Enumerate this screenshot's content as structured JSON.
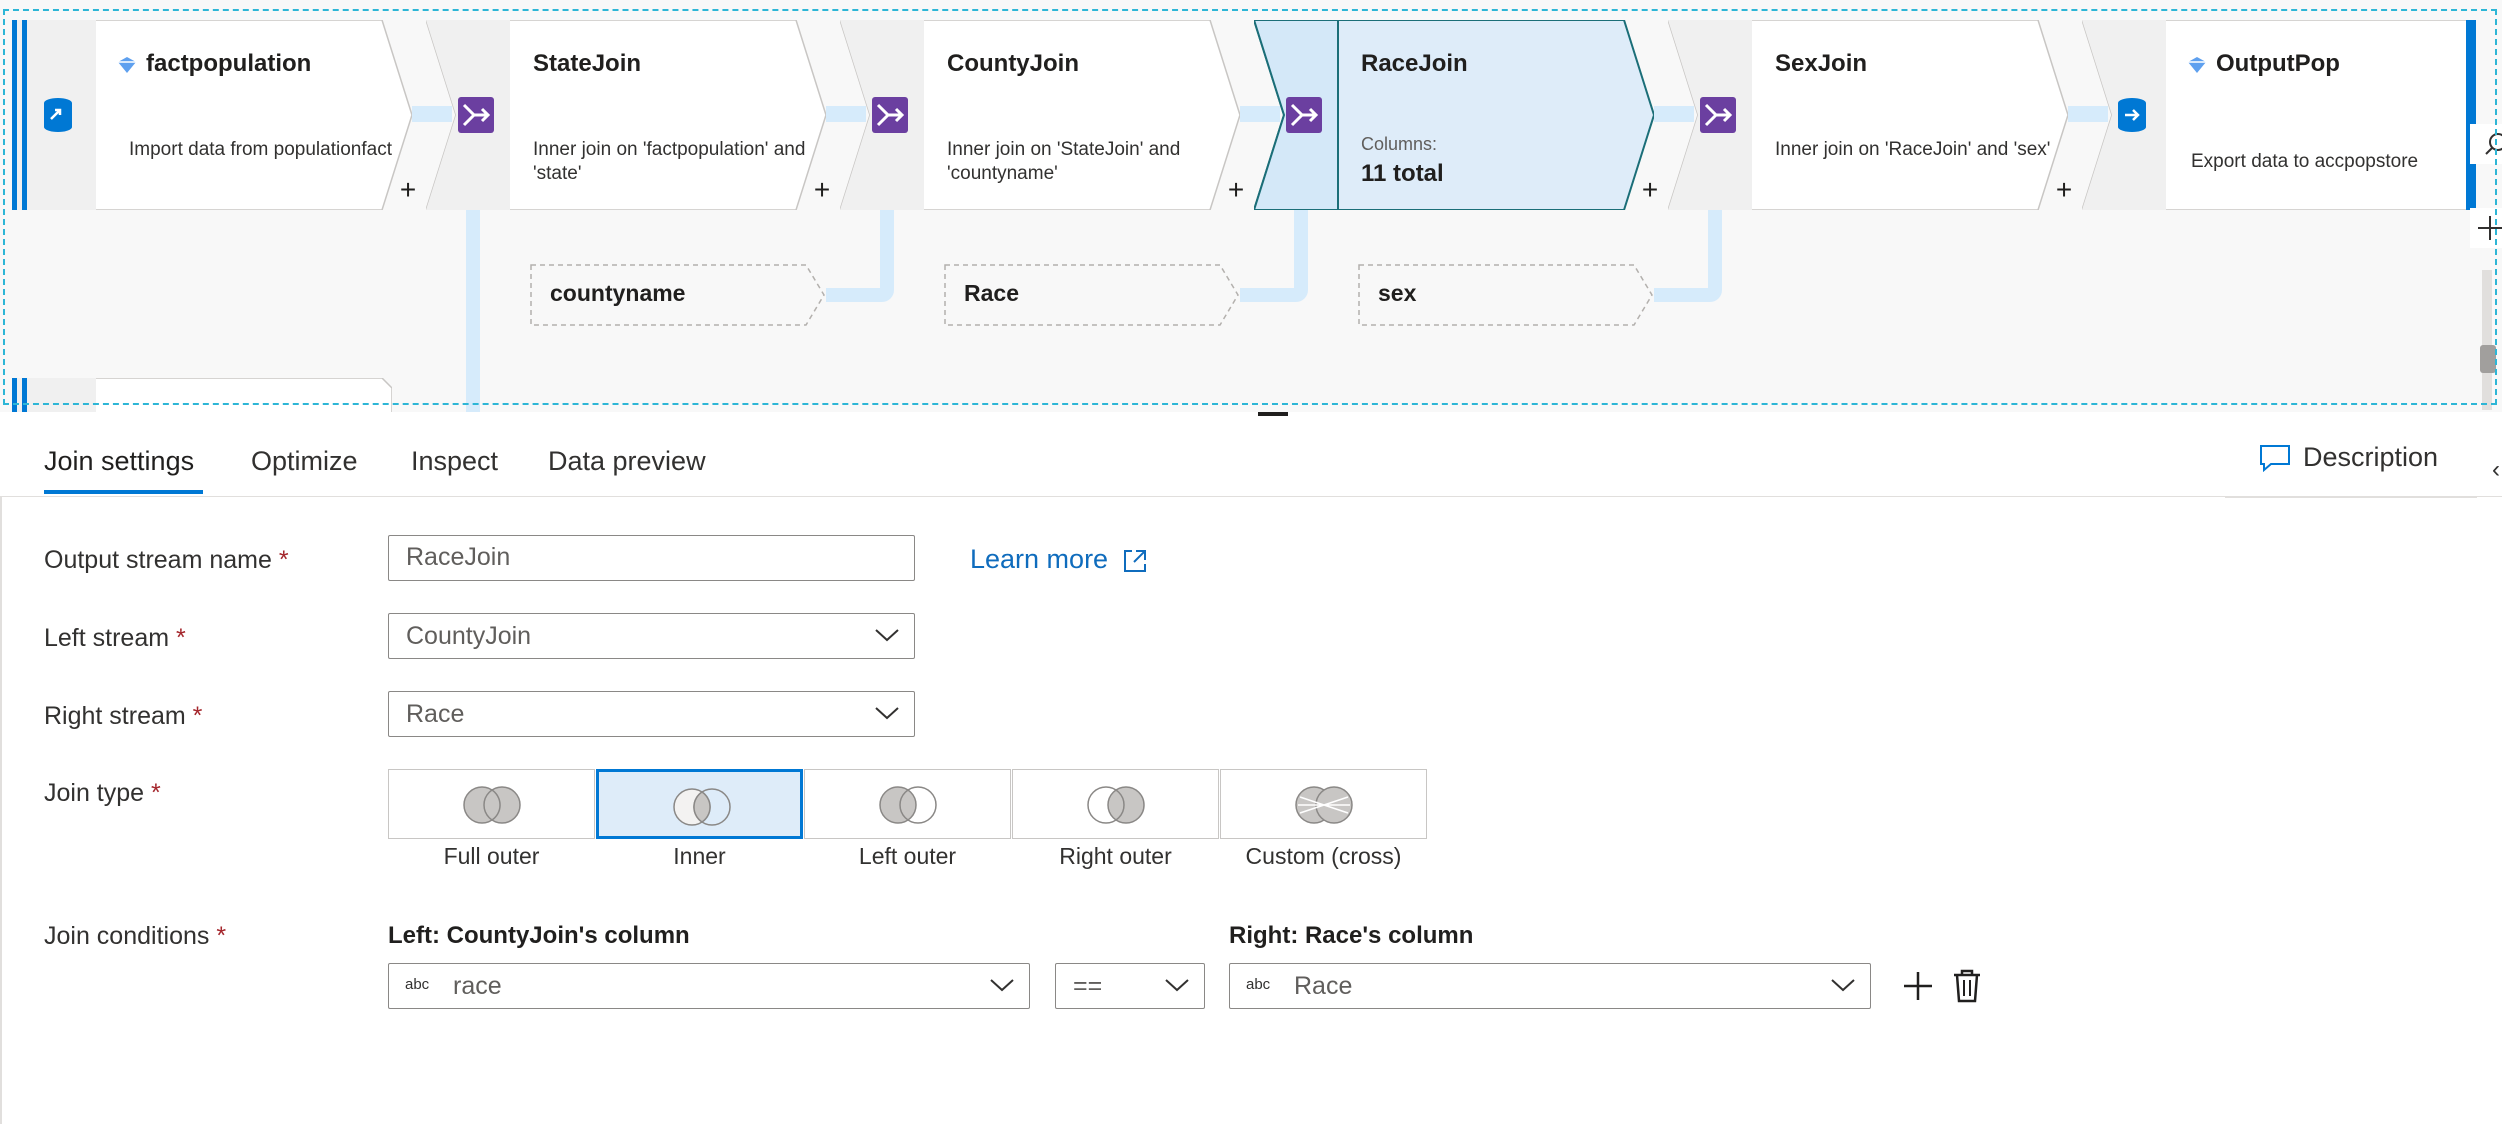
{
  "canvas": {
    "nodes": [
      {
        "id": "factpopulation",
        "title": "factpopulation",
        "desc": "Import data from populationfact",
        "kind": "source"
      },
      {
        "id": "statejoin",
        "title": "StateJoin",
        "desc": "Inner join on 'factpopulation' and 'state'",
        "kind": "join"
      },
      {
        "id": "countyjoin",
        "title": "CountyJoin",
        "desc": "Inner join on 'StateJoin' and 'countyname'",
        "kind": "join"
      },
      {
        "id": "racejoin",
        "title": "RaceJoin",
        "columns_label": "Columns:",
        "columns_value": "11 total",
        "kind": "join",
        "selected": true
      },
      {
        "id": "sexjoin",
        "title": "SexJoin",
        "desc": "Inner join on 'RaceJoin' and 'sex'",
        "kind": "join"
      },
      {
        "id": "outputpop",
        "title": "OutputPop",
        "desc": "Export data to accpopstore",
        "kind": "sink"
      }
    ],
    "plus": "+",
    "stream_tags": [
      "countyname",
      "Race",
      "sex"
    ]
  },
  "tabs": [
    {
      "label": "Join settings",
      "active": true
    },
    {
      "label": "Optimize"
    },
    {
      "label": "Inspect"
    },
    {
      "label": "Data preview"
    }
  ],
  "description_button": "Description",
  "form": {
    "output_stream_label": "Output stream name",
    "output_stream_value": "RaceJoin",
    "learn_more": "Learn more",
    "left_stream_label": "Left stream",
    "left_stream_value": "CountyJoin",
    "right_stream_label": "Right stream",
    "right_stream_value": "Race",
    "join_type_label": "Join type",
    "join_types": [
      {
        "label": "Full outer"
      },
      {
        "label": "Inner",
        "selected": true
      },
      {
        "label": "Left outer"
      },
      {
        "label": "Right outer"
      },
      {
        "label": "Custom (cross)"
      }
    ],
    "join_conditions_label": "Join conditions",
    "left_col_header": "Left: CountyJoin's column",
    "right_col_header": "Right: Race's column",
    "left_col_type": "abc",
    "left_col_value": "race",
    "operator": "==",
    "right_col_type": "abc",
    "right_col_value": "Race",
    "required_mark": "*"
  },
  "colors": {
    "accent": "#0078d4",
    "selected_bg": "#deecf9",
    "connector": "#d6ebfb",
    "join_icon": "#6b3fa0",
    "db_icon": "#0078d4"
  }
}
